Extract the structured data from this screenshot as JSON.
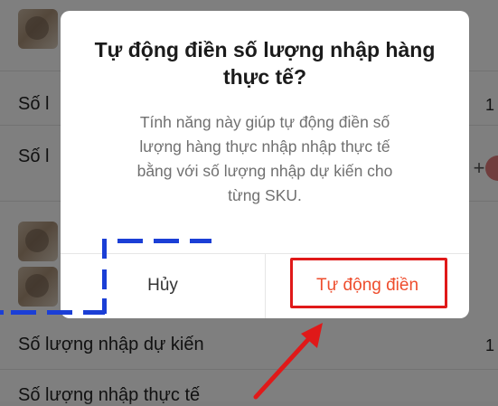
{
  "background": {
    "rows": [
      {
        "label": "Số l",
        "value": "1"
      },
      {
        "label": "Số l",
        "value": ""
      },
      {
        "label": "Số lượng nhập dự kiến",
        "value": "1"
      },
      {
        "label": "Số lượng nhập thực tế",
        "value": ""
      }
    ],
    "plus": "+"
  },
  "dialog": {
    "title_line1": "Tự động điền số lượng nhập hàng",
    "title_line2": "thực tế?",
    "body_line1": "Tính năng này giúp tự động điền số",
    "body_line2": "lượng hàng thực nhập nhập thực tế",
    "body_line3": "bằng với số lượng nhập dự kiến cho",
    "body_line4": "từng SKU.",
    "cancel_label": "Hủy",
    "confirm_label": "Tự động điền"
  },
  "colors": {
    "accent": "#ee4d2d",
    "highlight_box": "#e01919",
    "dashed_line": "#1b3fd6",
    "overlay": "rgba(0,0,0,0.5)"
  }
}
